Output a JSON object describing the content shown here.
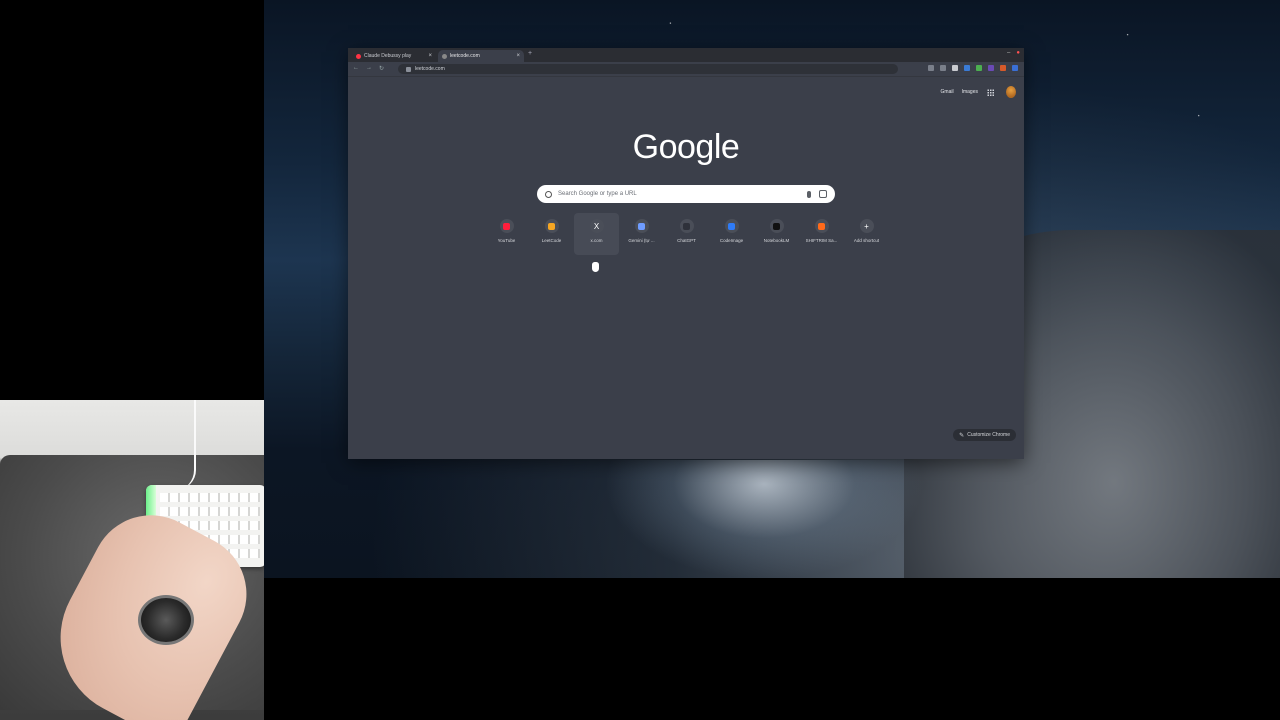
{
  "browser": {
    "tabs": [
      {
        "title": "Claude Debussy play",
        "favicon_color": "#ff3344",
        "active": false
      },
      {
        "title": "leetcode.com",
        "favicon_color": "#888888",
        "active": true
      }
    ],
    "new_tab_symbol": "+",
    "address": "leetcode.com",
    "nav": {
      "back": "←",
      "forward": "→",
      "reload": "↻"
    }
  },
  "ntp": {
    "header_links": [
      "Gmail",
      "Images"
    ],
    "logo": "Google",
    "search_placeholder": "Search Google or type a URL",
    "shortcuts": [
      {
        "label": "YouTube",
        "icon": "youtube-icon",
        "color": "#ff1e3c",
        "glyph": ""
      },
      {
        "label": "LeetCode",
        "icon": "leetcode-icon",
        "color": "#f5a623",
        "glyph": ""
      },
      {
        "label": "x.com",
        "icon": "x-icon",
        "color": "",
        "glyph": "X"
      },
      {
        "label": "Gemini (tự ...",
        "icon": "gemini-icon",
        "color": "#6f9cff",
        "glyph": ""
      },
      {
        "label": "ChatGPT",
        "icon": "chatgpt-icon",
        "color": "#2e313a",
        "glyph": ""
      },
      {
        "label": "CodeImage",
        "icon": "codeimage-icon",
        "color": "#2f7bf6",
        "glyph": ""
      },
      {
        "label": "NotebookLM",
        "icon": "notebooklm-icon",
        "color": "#111111",
        "glyph": ""
      },
      {
        "label": "SHIFTRIM Sa...",
        "icon": "shiftrim-icon",
        "color": "#ff6a1a",
        "glyph": ""
      },
      {
        "label": "Add shortcut",
        "icon": "plus-icon",
        "color": "",
        "glyph": "+"
      }
    ],
    "customize_label": "Customize Chrome"
  }
}
